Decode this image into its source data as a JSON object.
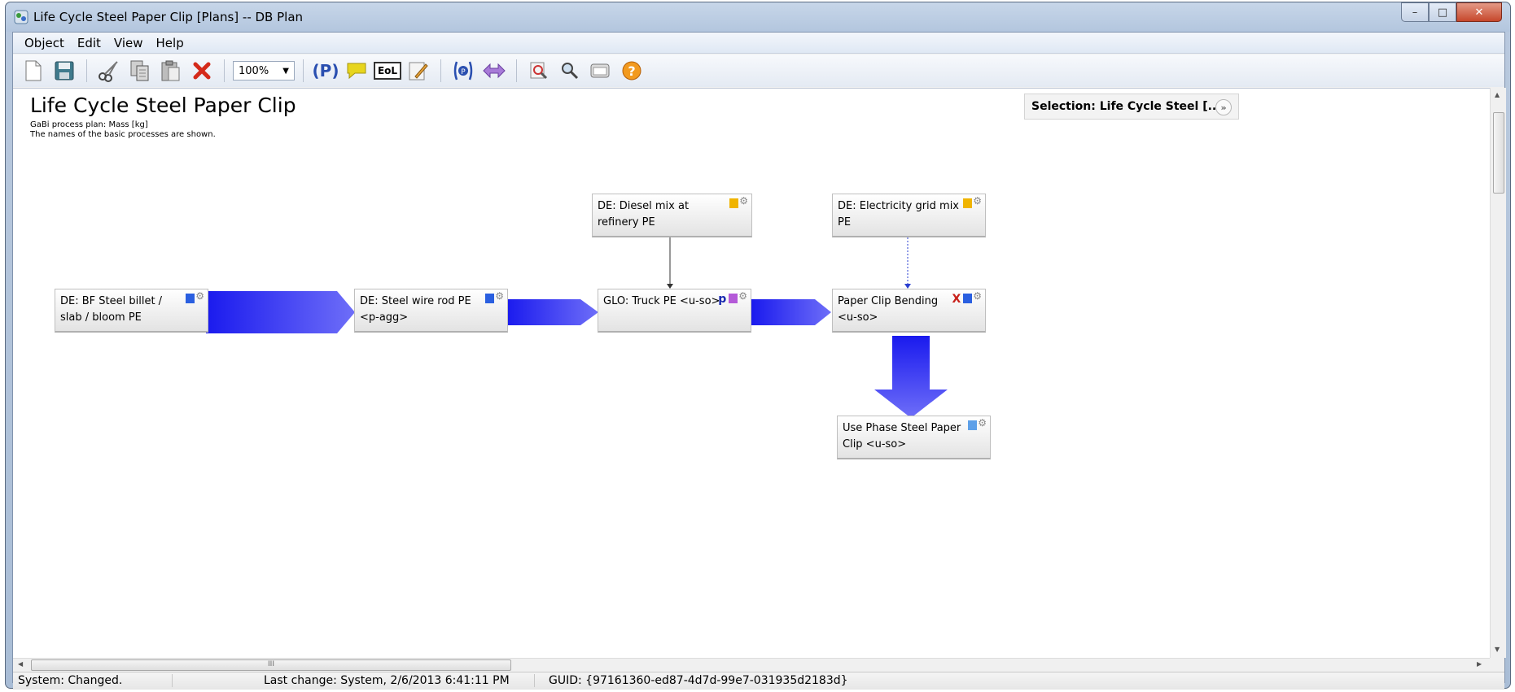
{
  "window": {
    "title": "Life Cycle Steel Paper Clip [Plans] -- DB Plan",
    "controls": {
      "minimize": "–",
      "maximize": "□",
      "close": "✕"
    }
  },
  "menu": {
    "items": [
      "Object",
      "Edit",
      "View",
      "Help"
    ]
  },
  "toolbar": {
    "zoom_value": "100%",
    "icons": [
      "new-icon",
      "save-icon",
      "cut-icon",
      "copy-icon",
      "paste-icon",
      "delete-icon",
      "zoom-select",
      "process-icon",
      "comment-icon",
      "eol-icon",
      "edit-icon",
      "process-search-icon",
      "flow-icon",
      "zoom-icon",
      "search-icon",
      "window-icon",
      "help-icon"
    ],
    "eol_label": "EoL",
    "p_label": "(P)"
  },
  "plan": {
    "title": "Life Cycle Steel Paper Clip",
    "subtitle1": "GaBi process plan: Mass [kg]",
    "subtitle2": "The names of the basic processes are shown."
  },
  "selection": {
    "label": "Selection: Life Cycle Steel  [...]",
    "expand": "»"
  },
  "processes": [
    {
      "id": "bf-steel",
      "name": "DE: BF Steel billet / slab / bloom PE",
      "icon_color": "#2a5fe0",
      "marker": ""
    },
    {
      "id": "wire-rod",
      "name": "DE: Steel wire rod PE <p-agg>",
      "icon_color": "#2a5fe0",
      "marker": ""
    },
    {
      "id": "truck",
      "name": "GLO: Truck PE <u-so>",
      "icon_color": "#b45ad8",
      "marker": "p"
    },
    {
      "id": "bending",
      "name": "Paper Clip Bending <u-so>",
      "icon_color": "#2a5fe0",
      "marker": "X"
    },
    {
      "id": "diesel",
      "name": "DE: Diesel mix at refinery PE",
      "icon_color": "#f0b400",
      "marker": ""
    },
    {
      "id": "electricity",
      "name": "DE: Electricity grid mix PE",
      "icon_color": "#f0b400",
      "marker": ""
    },
    {
      "id": "use-phase",
      "name": "Use Phase Steel Paper Clip <u-so>",
      "icon_color": "#5ea0e8",
      "marker": ""
    }
  ],
  "flow_colors": {
    "start": "#1a1aee",
    "end": "#6e6ef8"
  },
  "scrollbar": {
    "h_grip": "III"
  },
  "status": {
    "state": "System: Changed.",
    "last_change": "Last change: System, 2/6/2013 6:41:11 PM",
    "guid": "GUID: {97161360-ed87-4d7d-99e7-031935d2183d}"
  }
}
